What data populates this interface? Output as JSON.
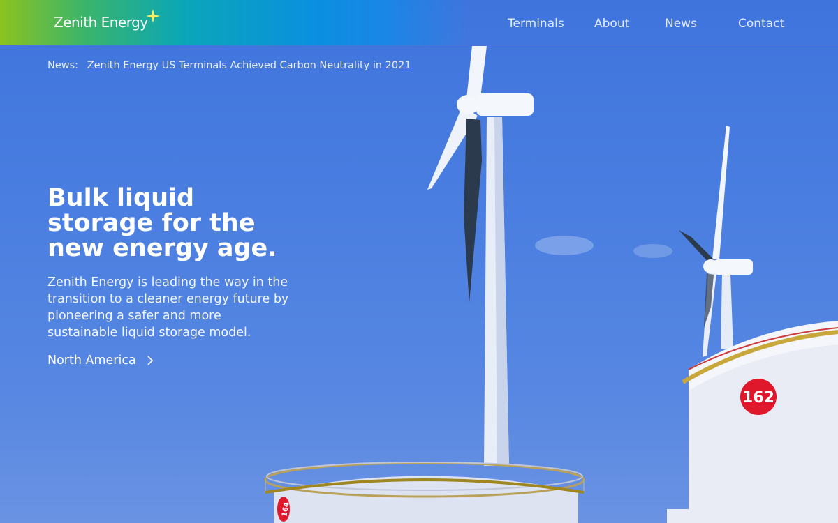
{
  "brand": {
    "name": "Zenith Energy",
    "accent_color": "#8cc21f",
    "star_color": "#f5f06a"
  },
  "nav": {
    "items": [
      {
        "label": "Terminals"
      },
      {
        "label": "About"
      },
      {
        "label": "News"
      },
      {
        "label": "Contact"
      }
    ]
  },
  "news_ticker": {
    "label": "News:",
    "headline": "Zenith Energy US Terminals Achieved Carbon Neutrality in 2021"
  },
  "hero": {
    "title_lines": [
      "Bulk liquid",
      "storage for the",
      "new energy age."
    ],
    "body_lines": [
      "Zenith Energy is leading the way in the",
      "transition to a cleaner energy future by",
      "pioneering a safer and more",
      "sustainable liquid storage model."
    ],
    "region_link": {
      "label": "North America",
      "icon": "chevron-right-icon"
    }
  },
  "background": {
    "sky_color": "#4a7ee0",
    "tank_numbers": [
      "162",
      "164"
    ],
    "tank_badge_color": "#e0182c"
  }
}
